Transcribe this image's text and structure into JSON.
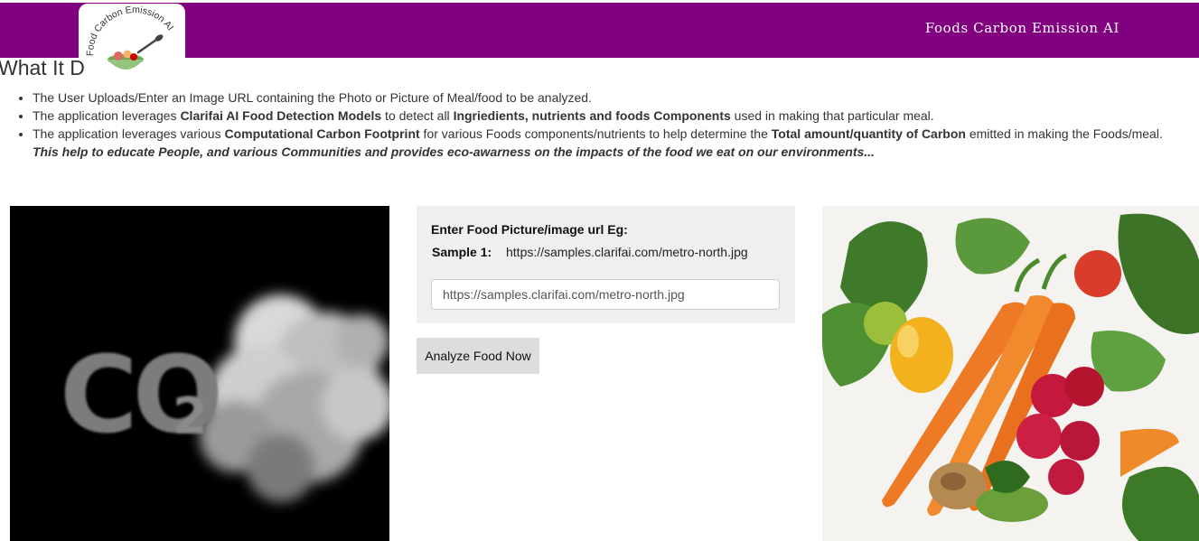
{
  "navbar": {
    "brand": "Foods Carbon Emission AI",
    "logo_text": "Food Carbon Emission AI"
  },
  "intro": {
    "title": "What It D",
    "bullets": [
      {
        "parts": [
          {
            "t": "The User Uploads/Enter an Image URL containing the Photo or Picture of Meal/food to be analyzed.",
            "b": false
          }
        ]
      },
      {
        "parts": [
          {
            "t": "The application leverages ",
            "b": false
          },
          {
            "t": "Clarifai AI Food Detection Models",
            "b": true
          },
          {
            "t": " to detect all ",
            "b": false
          },
          {
            "t": "Ingriedients, nutrients and foods Components",
            "b": true
          },
          {
            "t": " used in making that particular meal.",
            "b": false
          }
        ]
      },
      {
        "parts": [
          {
            "t": "The application leverages various ",
            "b": false
          },
          {
            "t": "Computational Carbon Footprint",
            "b": true
          },
          {
            "t": " for various Foods components/nutrients to help determine the ",
            "b": false
          },
          {
            "t": "Total amount/quantity of Carbon",
            "b": true
          },
          {
            "t": " emitted in making the Foods/meal.",
            "b": false
          }
        ]
      }
    ],
    "tagline": "This help to educate People, and various Communities and provides eco-awarness on the impacts of the food we eat on our environments..."
  },
  "form": {
    "heading": "Enter Food Picture/image url Eg:",
    "sample_label": "Sample 1:",
    "sample_url": "https://samples.clarifai.com/metro-north.jpg",
    "input_value": "https://samples.clarifai.com/metro-north.jpg",
    "button_label": "Analyze Food Now"
  },
  "images": {
    "co2_text": "CO",
    "co2_sub": "2"
  },
  "colors": {
    "navbar": "#800080",
    "panel": "#efefef",
    "button": "#dddddd"
  }
}
